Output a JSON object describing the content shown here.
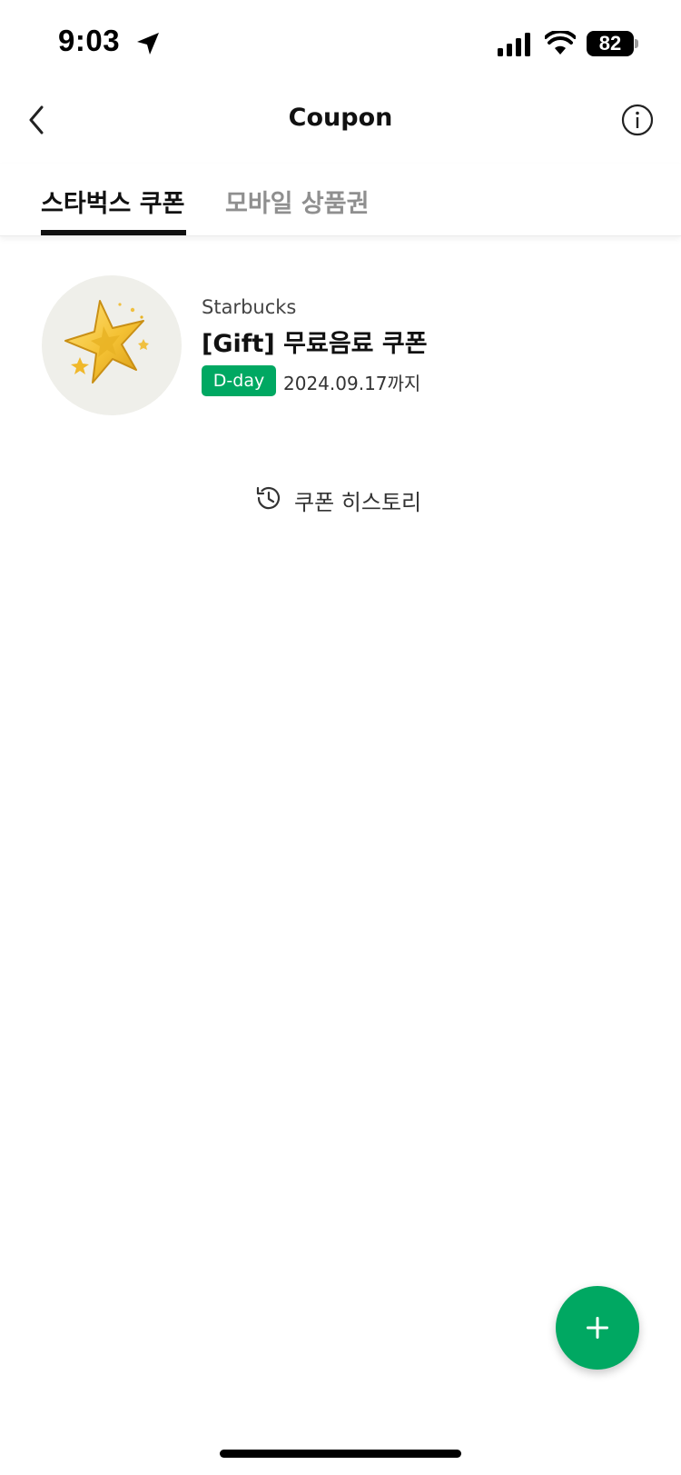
{
  "status_bar": {
    "time": "9:03",
    "battery": "82",
    "icons": [
      "location-arrow-icon",
      "signal-icon",
      "wifi-icon",
      "battery-icon"
    ]
  },
  "nav": {
    "title": "Coupon",
    "back_icon": "chevron-left-icon",
    "info_icon": "info-icon"
  },
  "tabs": [
    {
      "label": "스타벅스 쿠폰",
      "active": true
    },
    {
      "label": "모바일 상품권",
      "active": false
    }
  ],
  "coupons": [
    {
      "brand": "Starbucks",
      "name": "[Gift] 무료음료 쿠폰",
      "badge": "D-day",
      "expiry": "2024.09.17까지",
      "icon": "gold-star-icon"
    }
  ],
  "history": {
    "label": "쿠폰 히스토리",
    "icon": "history-clock-icon"
  },
  "fab": {
    "icon": "plus-icon"
  },
  "colors": {
    "accent": "#00a862",
    "text": "#111111",
    "muted": "#8f8f8f"
  }
}
